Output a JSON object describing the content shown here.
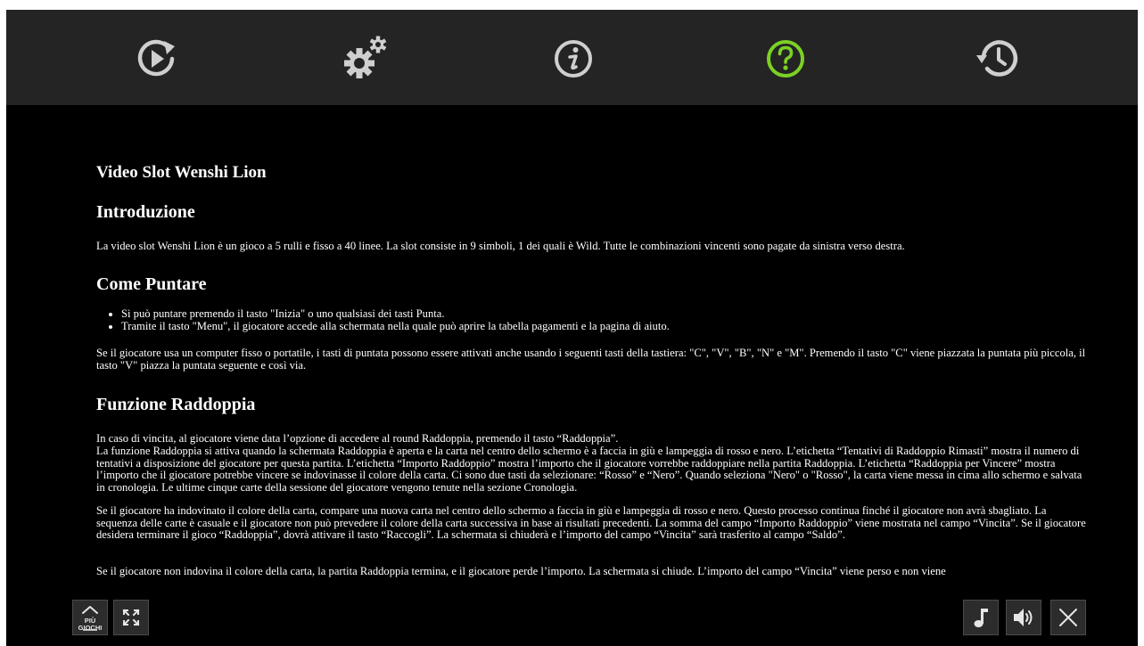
{
  "toolbar": {
    "items": [
      {
        "icon": "play-icon",
        "active": false
      },
      {
        "icon": "settings-icon",
        "active": false
      },
      {
        "icon": "info-icon",
        "active": false
      },
      {
        "icon": "help-icon",
        "active": true
      },
      {
        "icon": "history-icon",
        "active": false
      }
    ],
    "active_color": "#7bd124",
    "icon_color": "#cfcfcf"
  },
  "help": {
    "title": "Video Slot Wenshi Lion",
    "sections": {
      "intro": {
        "heading": "Introduzione",
        "text": "La video slot Wenshi Lion è un gioco a 5 rulli e fisso a 40 linee. La slot consiste in 9 simboli, 1 dei quali è Wild. Tutte le combinazioni vincenti sono pagate da sinistra verso destra."
      },
      "betting": {
        "heading": "Come Puntare",
        "bullets": [
          "Si può puntare premendo il tasto \"Inizia\" o uno qualsiasi dei tasti Punta.",
          "Tramite il tasto \"Menu\", il giocatore accede alla schermata nella quale può aprire la tabella pagamenti e la pagina di aiuto."
        ],
        "text": "Se il giocatore usa un computer fisso o portatile, i tasti di puntata possono essere attivati anche usando i seguenti tasti della tastiera: \"C\", \"V\", \"B\", \"N\" e \"M\". Premendo il tasto \"C\" viene piazzata la puntata più piccola, il tasto \"V\" piazza la puntata seguente e così via."
      },
      "gamble": {
        "heading": "Funzione Raddoppia",
        "paragraphs": [
          "In caso di vincita, al giocatore viene data l’opzione di accedere al round Raddoppia, premendo il tasto “Raddoppia”.",
          "La funzione Raddoppia si attiva quando la schermata Raddoppia è aperta e la carta nel centro dello schermo è a faccia in giù e lampeggia di rosso e nero. L’etichetta “Tentativi di Raddoppio Rimasti” mostra il numero di tentativi a disposizione del giocatore per questa partita. L’etichetta “Importo Raddoppio” mostra l’importo che il giocatore vorrebbe raddoppiare nella partita Raddoppia. L’etichetta “Raddoppia per Vincere” mostra l’importo che il giocatore potrebbe vincere se indovinasse il colore della carta. Ci sono due tasti da selezionare: “Rosso” e “Nero”. Quando seleziona \"Nero\" o \"Rosso\", la carta viene messa in cima allo schermo e salvata in cronologia. Le ultime cinque carte della sessione del giocatore vengono tenute nella sezione Cronologia.",
          "Se il giocatore ha indovinato il colore della carta, compare una nuova carta nel centro dello schermo a faccia in giù e lampeggia di rosso e nero. Questo processo continua finché il giocatore non avrà sbagliato. La sequenza delle carte è casuale e il giocatore non può prevedere il colore della carta successiva in base ai risultati precedenti. La somma del campo “Importo Raddoppio” viene mostrata nel campo “Vincita”. Se il giocatore desidera terminare il gioco “Raddoppia”, dovrà attivare il tasto “Raccogli”. La schermata si chiuderà e l’importo del campo “Vincita” sarà trasferito al campo “Saldo”.",
          "Se il giocatore non indovina il colore della carta, la partita Raddoppia termina, e il giocatore perde l’importo. La schermata si chiude. L’importo del campo “Vincita” viene perso e non viene"
        ]
      }
    }
  },
  "bottom": {
    "more_games_line1": "PIÙ",
    "more_games_line2": "GIOCHI",
    "buttons": [
      "more-games-icon",
      "fullscreen-icon",
      "music-note-icon",
      "speaker-icon",
      "close-icon"
    ]
  }
}
